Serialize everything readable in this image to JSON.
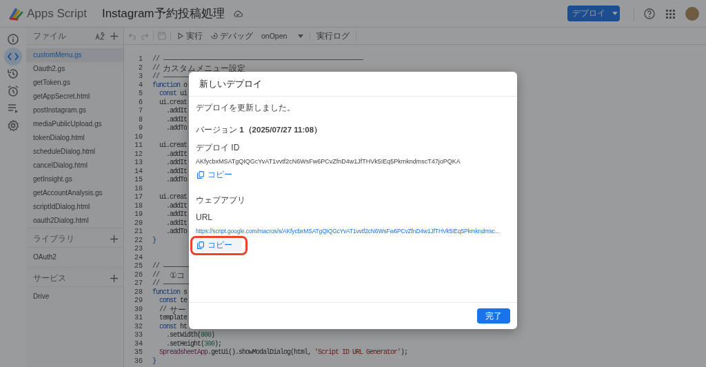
{
  "header": {
    "product": "Apps Script",
    "project_title": "Instagram予約投稿処理",
    "deploy_button": "デプロイ"
  },
  "rail": [
    {
      "kind": "info",
      "selected": false
    },
    {
      "kind": "code",
      "selected": true
    },
    {
      "kind": "history",
      "selected": false
    },
    {
      "kind": "alarm",
      "selected": false
    },
    {
      "kind": "runs",
      "selected": false
    },
    {
      "kind": "gear",
      "selected": false
    }
  ],
  "files_panel": {
    "title": "ファイル",
    "files": [
      {
        "name": "customMenu.gs",
        "selected": true
      },
      {
        "name": "Oauth2.gs",
        "selected": false
      },
      {
        "name": "getToken.gs",
        "selected": false
      },
      {
        "name": "getAppSecret.html",
        "selected": false
      },
      {
        "name": "postInstagram.gs",
        "selected": false
      },
      {
        "name": "mediaPublicUpload.gs",
        "selected": false
      },
      {
        "name": "tokenDialog.html",
        "selected": false
      },
      {
        "name": "scheduleDialog.html",
        "selected": false
      },
      {
        "name": "cancelDialog.html",
        "selected": false
      },
      {
        "name": "getInsight.gs",
        "selected": false
      },
      {
        "name": "getAccountAnalysis.gs",
        "selected": false
      },
      {
        "name": "scriptIdDialog.html",
        "selected": false
      },
      {
        "name": "oauth2Dialog.html",
        "selected": false
      }
    ],
    "sections": [
      {
        "title": "ライブラリ",
        "items": [
          "OAuth2"
        ]
      },
      {
        "title": "サービス",
        "items": [
          "Drive"
        ]
      }
    ]
  },
  "toolbar": [
    {
      "kind": "undo",
      "disabled": true
    },
    {
      "kind": "redo",
      "disabled": true
    },
    {
      "kind": "save",
      "disabled": true
    },
    {
      "kind": "run",
      "label": "実行"
    },
    {
      "kind": "debug",
      "label": "デバッグ"
    },
    {
      "kind": "select",
      "label": "onOpen"
    },
    {
      "kind": "text",
      "label": "実行ログ"
    }
  ],
  "code_lines": [
    {
      "n": "1",
      "rule": true,
      "tokens": [
        {
          "kind": "comment",
          "text": "//"
        }
      ]
    },
    {
      "n": "2",
      "tokens": [
        {
          "kind": "comment",
          "text": "// "
        },
        {
          "kind": "jp",
          "text": "カスタムメニュー設定"
        }
      ]
    },
    {
      "n": "3",
      "rule": true,
      "tokens": [
        {
          "kind": "comment",
          "text": "//"
        }
      ]
    },
    {
      "n": "4",
      "tokens": [
        {
          "kind": "keyword",
          "text": "function"
        },
        {
          "kind": "plain",
          "text": " o"
        }
      ]
    },
    {
      "n": "5",
      "tokens": [
        {
          "kind": "keyword",
          "text": "  const"
        },
        {
          "kind": "plain",
          "text": " ui"
        }
      ]
    },
    {
      "n": "6",
      "tokens": [
        {
          "kind": "plain",
          "text": "  ui.creat"
        }
      ]
    },
    {
      "n": "7",
      "tokens": [
        {
          "kind": "plain",
          "text": "    .addIt"
        }
      ]
    },
    {
      "n": "8",
      "tokens": [
        {
          "kind": "plain",
          "text": "    .addIt"
        }
      ]
    },
    {
      "n": "9",
      "tokens": [
        {
          "kind": "plain",
          "text": "    .addTo"
        }
      ]
    },
    {
      "n": "10"
    },
    {
      "n": "11",
      "tokens": [
        {
          "kind": "plain",
          "text": "  ui.creat"
        }
      ]
    },
    {
      "n": "12",
      "tokens": [
        {
          "kind": "plain",
          "text": "    .addIt"
        }
      ]
    },
    {
      "n": "13",
      "tokens": [
        {
          "kind": "plain",
          "text": "    .addIt"
        }
      ]
    },
    {
      "n": "14",
      "tokens": [
        {
          "kind": "plain",
          "text": "    .addIt"
        }
      ]
    },
    {
      "n": "15",
      "tokens": [
        {
          "kind": "plain",
          "text": "    .addTo"
        }
      ]
    },
    {
      "n": "16"
    },
    {
      "n": "17",
      "tokens": [
        {
          "kind": "plain",
          "text": "  ui.creat"
        }
      ]
    },
    {
      "n": "18",
      "tokens": [
        {
          "kind": "plain",
          "text": "    .addIt"
        }
      ]
    },
    {
      "n": "19",
      "tokens": [
        {
          "kind": "plain",
          "text": "    .addIt"
        }
      ]
    },
    {
      "n": "20",
      "tokens": [
        {
          "kind": "plain",
          "text": "    .addIt"
        }
      ]
    },
    {
      "n": "21",
      "tokens": [
        {
          "kind": "plain",
          "text": "    .addTo"
        }
      ]
    },
    {
      "n": "22",
      "tokens": [
        {
          "kind": "bracket",
          "text": "}"
        }
      ]
    },
    {
      "n": "23"
    },
    {
      "n": "24"
    },
    {
      "n": "25",
      "rule": true,
      "tokens": [
        {
          "kind": "comment",
          "text": "//"
        }
      ]
    },
    {
      "n": "26",
      "tokens": [
        {
          "kind": "comment",
          "text": "//   "
        },
        {
          "kind": "jp",
          "text": "①コ"
        }
      ]
    },
    {
      "n": "27",
      "rule": true,
      "tokens": [
        {
          "kind": "comment",
          "text": "//"
        }
      ]
    },
    {
      "n": "28",
      "tokens": [
        {
          "kind": "keyword",
          "text": "function"
        },
        {
          "kind": "plain",
          "text": " s"
        }
      ]
    },
    {
      "n": "29",
      "tokens": [
        {
          "kind": "keyword",
          "text": "  const"
        },
        {
          "kind": "plain",
          "text": " te"
        }
      ]
    },
    {
      "n": "30",
      "tokens": [
        {
          "kind": "comment",
          "text": "  // "
        },
        {
          "kind": "jp",
          "text": "サー"
        }
      ]
    },
    {
      "n": "31",
      "tokens": [
        {
          "kind": "plain",
          "text": "  template"
        }
      ]
    },
    {
      "n": "32",
      "tokens": [
        {
          "kind": "keyword",
          "text": "  const"
        },
        {
          "kind": "plain",
          "text": " ht"
        }
      ]
    },
    {
      "n": "33",
      "tokens": [
        {
          "kind": "plain",
          "text": "    .setWidth("
        },
        {
          "kind": "number",
          "text": "800"
        },
        {
          "kind": "plain",
          "text": ")"
        }
      ]
    },
    {
      "n": "34",
      "tokens": [
        {
          "kind": "plain",
          "text": "    .setHeight("
        },
        {
          "kind": "number",
          "text": "300"
        },
        {
          "kind": "plain",
          "text": ");"
        }
      ]
    },
    {
      "n": "35",
      "tokens": [
        {
          "kind": "class",
          "text": "  SpreadsheetApp"
        },
        {
          "kind": "plain",
          "text": ".getUi().showModalDialog(html, "
        },
        {
          "kind": "string",
          "text": "'Script ID URL Generator'"
        },
        {
          "kind": "plain",
          "text": ");"
        }
      ]
    },
    {
      "n": "36",
      "tokens": [
        {
          "kind": "bracket",
          "text": "}"
        }
      ]
    }
  ],
  "dialog": {
    "title": "新しいデプロイ",
    "message": "デプロイを更新しました。",
    "version": "バージョン **1（2025/07/27 11:08）**",
    "deploy_id_label": "デプロイ ID",
    "deploy_id": "AKfycbxMSATgQIQGcYvAT1vvtf2cN6WsFw6PCvZfnD4w1JfTHVk5IEq5PkmkndmscT47joPQKA",
    "deploy_id_copy": {
      "label": "コピー",
      "highlighted": false
    },
    "webapp_heading": "ウェブアプリ",
    "url_label": "URL",
    "url": "https://script.google.com/macros/s/AKfycbxMSATgQIQGcYvAT1vvtf2cN6WsFw6PCvZfnD4w1JfTHVk5IEq5Pkmkndmsc...",
    "url_copy": {
      "label": "コピー",
      "highlighted": true
    },
    "done_button": "完了"
  }
}
